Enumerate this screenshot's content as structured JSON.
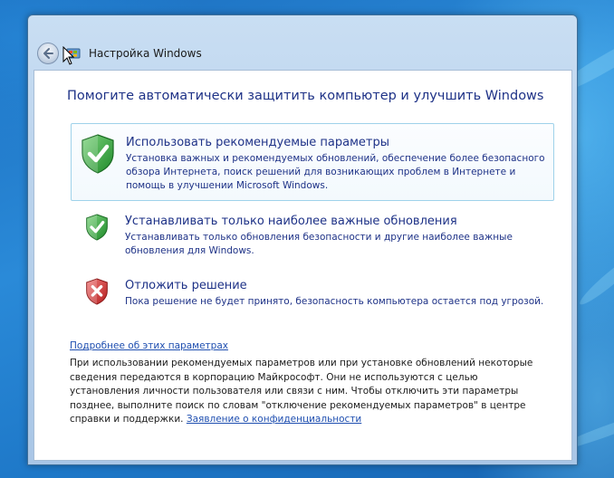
{
  "window": {
    "title": "Настройка Windows"
  },
  "main": {
    "heading": "Помогите автоматически защитить компьютер и улучшить Windows",
    "options": [
      {
        "title": "Использовать рекомендуемые параметры",
        "desc_lines": [
          "Установка важных и рекомендуемых обновлений, обеспечение более безопасного",
          "обзора Интернета, поиск решений для возникающих проблем в Интернете и",
          "помощь в улучшении Microsoft Windows."
        ],
        "icon": "green-shield-check-icon"
      },
      {
        "title": "Устанавливать только наиболее важные обновления",
        "desc_lines": [
          "Устанавливать только обновления безопасности и другие наиболее важные",
          "обновления для Windows."
        ],
        "icon": "green-shield-check-icon"
      },
      {
        "title": "Отложить решение",
        "desc_lines": [
          "Пока решение не будет принято, безопасность компьютера остается под угрозой."
        ],
        "icon": "red-shield-x-icon"
      }
    ],
    "more_link": "Подробнее об этих параметрах",
    "info_lines": [
      "При использовании рекомендуемых параметров или при установке обновлений некоторые",
      "сведения передаются в корпорацию Майкрософт. Они не используются с целью",
      "установления личности пользователя или связи с ним. Чтобы отключить эти параметры",
      "позднее, выполните поиск по словам \"отключение рекомендуемых параметров\" в центре",
      "справки и поддержки."
    ],
    "privacy_link": "Заявление о конфиденциальности"
  },
  "colors": {
    "heading": "#1e3287",
    "link": "#1f4fb0",
    "shield_green": "#3aa23a",
    "shield_red": "#cc2b2b"
  }
}
